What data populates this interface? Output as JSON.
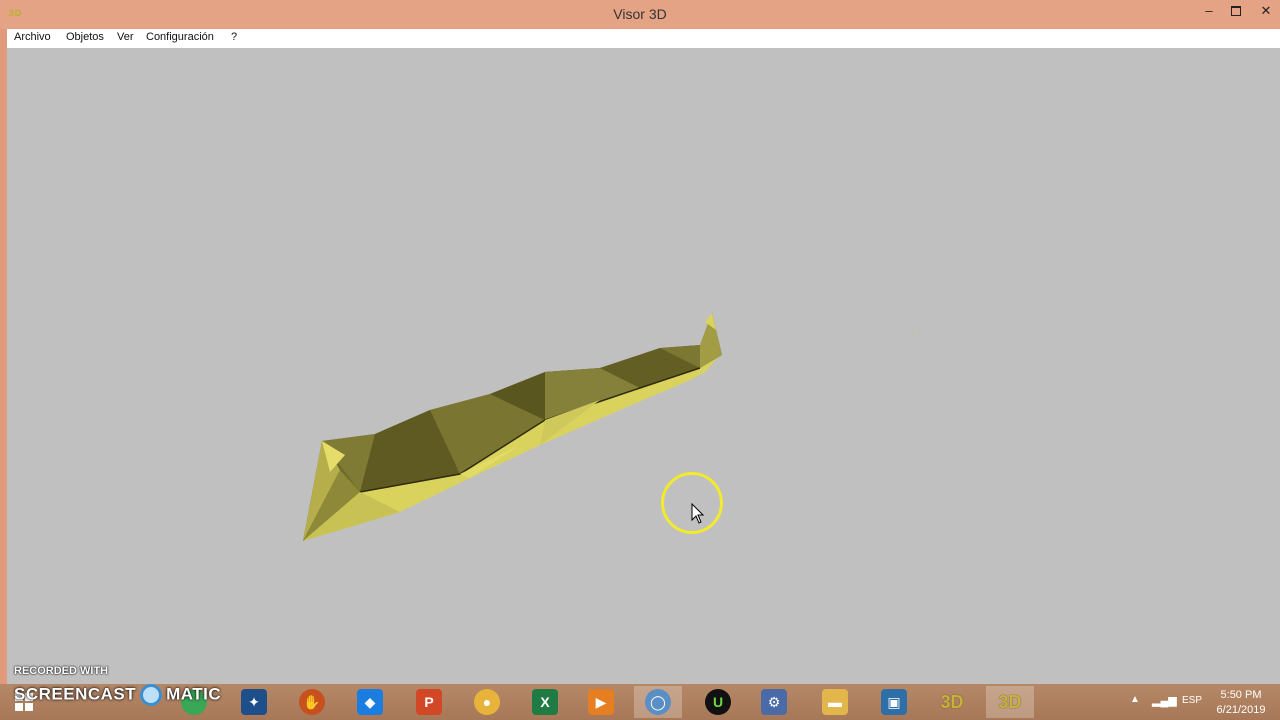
{
  "window": {
    "title": "Visor 3D",
    "icon": "3D",
    "controls": {
      "minimize": "–",
      "close": "✕"
    }
  },
  "menubar": {
    "items": [
      "Archivo",
      "Objetos",
      "Ver",
      "Configuración",
      "?"
    ]
  },
  "overlay": {
    "recorded_with": "RECORDED WITH",
    "brand_left": "SCREENCAST",
    "brand_right": "MATIC"
  },
  "taskbar": {
    "icons": [
      {
        "name": "start-icon",
        "glyph": "",
        "color": "#3b7fd0"
      },
      {
        "name": "screencast-matic-icon",
        "glyph": "",
        "color": "#3b8fd0"
      },
      {
        "name": "chrome-icon",
        "glyph": "",
        "color": "#3aa757"
      },
      {
        "name": "video-editor-icon",
        "glyph": "✦",
        "color": "#1f4f8a"
      },
      {
        "name": "baseball-glove-icon",
        "glyph": "✋",
        "color": "#c8501e"
      },
      {
        "name": "dropbox-icon",
        "glyph": "◆",
        "color": "#1b7de0"
      },
      {
        "name": "powerpoint-icon",
        "glyph": "P",
        "color": "#d24726"
      },
      {
        "name": "paint-icon",
        "glyph": "●",
        "color": "#e8b33b"
      },
      {
        "name": "excel-icon",
        "glyph": "X",
        "color": "#1f7a44"
      },
      {
        "name": "media-player-icon",
        "glyph": "▶",
        "color": "#e67e22"
      },
      {
        "name": "cortana-icon",
        "glyph": "◯",
        "color": "#5a8fc6"
      },
      {
        "name": "upwork-icon",
        "glyph": "U",
        "color": "#111111"
      },
      {
        "name": "workflow-icon",
        "glyph": "⚙",
        "color": "#4a6aa8"
      },
      {
        "name": "file-explorer-icon",
        "glyph": "▬",
        "color": "#e2b64a"
      },
      {
        "name": "image-viewer-icon",
        "glyph": "▣",
        "color": "#2f6fa8"
      },
      {
        "name": "visor3d-icon-1",
        "glyph": "3D",
        "color": "#c9b336"
      },
      {
        "name": "visor3d-icon-2",
        "glyph": "3D",
        "color": "#c9b336"
      }
    ],
    "tray": {
      "language": "ESP",
      "time": "5:50 PM",
      "date": "6/21/2019"
    }
  }
}
